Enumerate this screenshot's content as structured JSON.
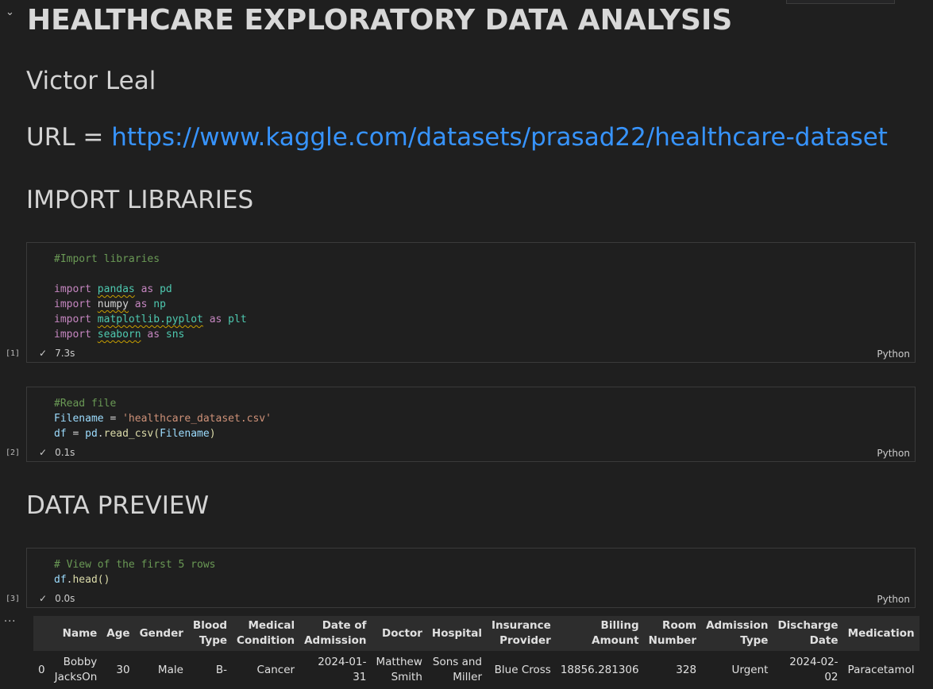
{
  "notebook": {
    "title": "HEALTHCARE EXPLORATORY DATA ANALYSIS",
    "author": "Victor Leal",
    "url_prefix": "URL = ",
    "url": "https://www.kaggle.com/datasets/prasad22/healthcare-dataset",
    "section_import": "IMPORT LIBRARIES",
    "section_preview": "DATA PREVIEW"
  },
  "cells": [
    {
      "exec_count": "[1]",
      "status_time": "7.3s",
      "language": "Python",
      "lines": {
        "comment": "#Import libraries",
        "l1": {
          "kw": "import",
          "mod": "pandas",
          "as": "as",
          "alias": "pd"
        },
        "l2": {
          "kw": "import",
          "mod": "numpy",
          "as": "as",
          "alias": "np"
        },
        "l3": {
          "kw": "import",
          "mod": "matplotlib.pyplot",
          "as": "as",
          "alias": "plt"
        },
        "l4": {
          "kw": "import",
          "mod": "seaborn",
          "as": "as",
          "alias": "sns"
        }
      }
    },
    {
      "exec_count": "[2]",
      "status_time": "0.1s",
      "language": "Python",
      "lines": {
        "comment": "#Read file",
        "var": "Filename",
        "eq": " = ",
        "str": "'healthcare_dataset.csv'",
        "df": "df",
        "eq2": " = ",
        "pd": "pd",
        "dot": ".",
        "fn": "read_csv",
        "open": "(",
        "arg": "Filename",
        "close": ")"
      }
    },
    {
      "exec_count": "[3]",
      "status_time": "0.0s",
      "language": "Python",
      "lines": {
        "comment": "# View of the first 5 rows",
        "df": "df",
        "dot": ".",
        "fn": "head",
        "parens": "()"
      }
    }
  ],
  "output": {
    "more": "...",
    "headers": [
      "",
      "Name",
      "Age",
      "Gender",
      "Blood Type",
      "Medical Condition",
      "Date of Admission",
      "Doctor",
      "Hospital",
      "Insurance Provider",
      "Billing Amount",
      "Room Number",
      "Admission Type",
      "Discharge Date",
      "Medication"
    ],
    "rows": [
      [
        "0",
        "Bobby JacksOn",
        "30",
        "Male",
        "B-",
        "Cancer",
        "2024-01-31",
        "Matthew Smith",
        "Sons and Miller",
        "Blue Cross",
        "18856.281306",
        "328",
        "Urgent",
        "2024-02-02",
        "Paracetamol"
      ]
    ]
  }
}
